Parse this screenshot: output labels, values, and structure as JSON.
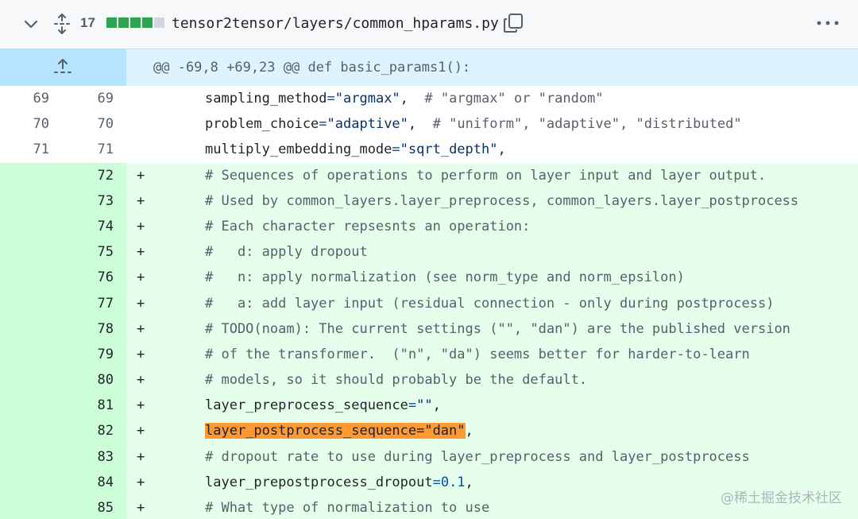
{
  "file": {
    "changes": "17",
    "diffstat": [
      "added",
      "added",
      "added",
      "added",
      "neutral"
    ],
    "path": "tensor2tensor/layers/common_hparams.py"
  },
  "hunk": {
    "header": "@@ -69,8 +69,23 @@ def basic_params1():"
  },
  "lines": [
    {
      "type": "context",
      "old": "69",
      "new": "69",
      "sign": "",
      "parts": [
        {
          "t": "sampling_method"
        },
        {
          "t": "=",
          "c": "op"
        },
        {
          "t": "\"argmax\"",
          "c": "str"
        },
        {
          "t": ",  "
        },
        {
          "t": "# \"argmax\" or \"random\"",
          "c": "com"
        }
      ]
    },
    {
      "type": "context",
      "old": "70",
      "new": "70",
      "sign": "",
      "parts": [
        {
          "t": "problem_choice"
        },
        {
          "t": "=",
          "c": "op"
        },
        {
          "t": "\"adaptive\"",
          "c": "str"
        },
        {
          "t": ",  "
        },
        {
          "t": "# \"uniform\", \"adaptive\", \"distributed\"",
          "c": "com"
        }
      ]
    },
    {
      "type": "context",
      "old": "71",
      "new": "71",
      "sign": "",
      "parts": [
        {
          "t": "multiply_embedding_mode"
        },
        {
          "t": "=",
          "c": "op"
        },
        {
          "t": "\"sqrt_depth\"",
          "c": "str"
        },
        {
          "t": ","
        }
      ]
    },
    {
      "type": "addition",
      "old": "",
      "new": "72",
      "sign": "+",
      "parts": [
        {
          "t": "# Sequences of operations to perform on layer input and layer output.",
          "c": "com"
        }
      ]
    },
    {
      "type": "addition",
      "old": "",
      "new": "73",
      "sign": "+",
      "parts": [
        {
          "t": "# Used by common_layers.layer_preprocess, common_layers.layer_postprocess",
          "c": "com"
        }
      ]
    },
    {
      "type": "addition",
      "old": "",
      "new": "74",
      "sign": "+",
      "parts": [
        {
          "t": "# Each character repsesnts an operation:",
          "c": "com"
        }
      ]
    },
    {
      "type": "addition",
      "old": "",
      "new": "75",
      "sign": "+",
      "parts": [
        {
          "t": "#   d: apply dropout",
          "c": "com"
        }
      ]
    },
    {
      "type": "addition",
      "old": "",
      "new": "76",
      "sign": "+",
      "parts": [
        {
          "t": "#   n: apply normalization (see norm_type and norm_epsilon)",
          "c": "com"
        }
      ]
    },
    {
      "type": "addition",
      "old": "",
      "new": "77",
      "sign": "+",
      "parts": [
        {
          "t": "#   a: add layer input (residual connection - only during postprocess)",
          "c": "com"
        }
      ]
    },
    {
      "type": "addition",
      "old": "",
      "new": "78",
      "sign": "+",
      "parts": [
        {
          "t": "# TODO(noam): The current settings (\"\", \"dan\") are the published version",
          "c": "com"
        }
      ]
    },
    {
      "type": "addition",
      "old": "",
      "new": "79",
      "sign": "+",
      "parts": [
        {
          "t": "# of the transformer.  (\"n\", \"da\") seems better for harder-to-learn",
          "c": "com"
        }
      ]
    },
    {
      "type": "addition",
      "old": "",
      "new": "80",
      "sign": "+",
      "parts": [
        {
          "t": "# models, so it should probably be the default.",
          "c": "com"
        }
      ]
    },
    {
      "type": "addition",
      "old": "",
      "new": "81",
      "sign": "+",
      "parts": [
        {
          "t": "layer_preprocess_sequence"
        },
        {
          "t": "=",
          "c": "op"
        },
        {
          "t": "\"\"",
          "c": "str"
        },
        {
          "t": ","
        }
      ]
    },
    {
      "type": "addition",
      "old": "",
      "new": "82",
      "sign": "+",
      "parts": [
        {
          "t": "layer_postprocess_sequence=\"dan\"",
          "c": "hl"
        },
        {
          "t": ","
        }
      ]
    },
    {
      "type": "addition",
      "old": "",
      "new": "83",
      "sign": "+",
      "parts": [
        {
          "t": "# dropout rate to use during layer_preprocess and layer_postprocess",
          "c": "com"
        }
      ]
    },
    {
      "type": "addition",
      "old": "",
      "new": "84",
      "sign": "+",
      "parts": [
        {
          "t": "layer_prepostprocess_dropout"
        },
        {
          "t": "=",
          "c": "op"
        },
        {
          "t": "0.1",
          "c": "num"
        },
        {
          "t": ","
        }
      ]
    },
    {
      "type": "addition",
      "old": "",
      "new": "85",
      "sign": "+",
      "parts": [
        {
          "t": "# What type of normalization to use",
          "c": "com"
        }
      ]
    }
  ],
  "watermark": "@稀土掘金技术社区",
  "colors": {
    "addition_bg": "#e6ffec",
    "addition_gutter": "#ccffd8",
    "hunk_bg": "#ddf4ff",
    "highlight": "#ff9933"
  }
}
